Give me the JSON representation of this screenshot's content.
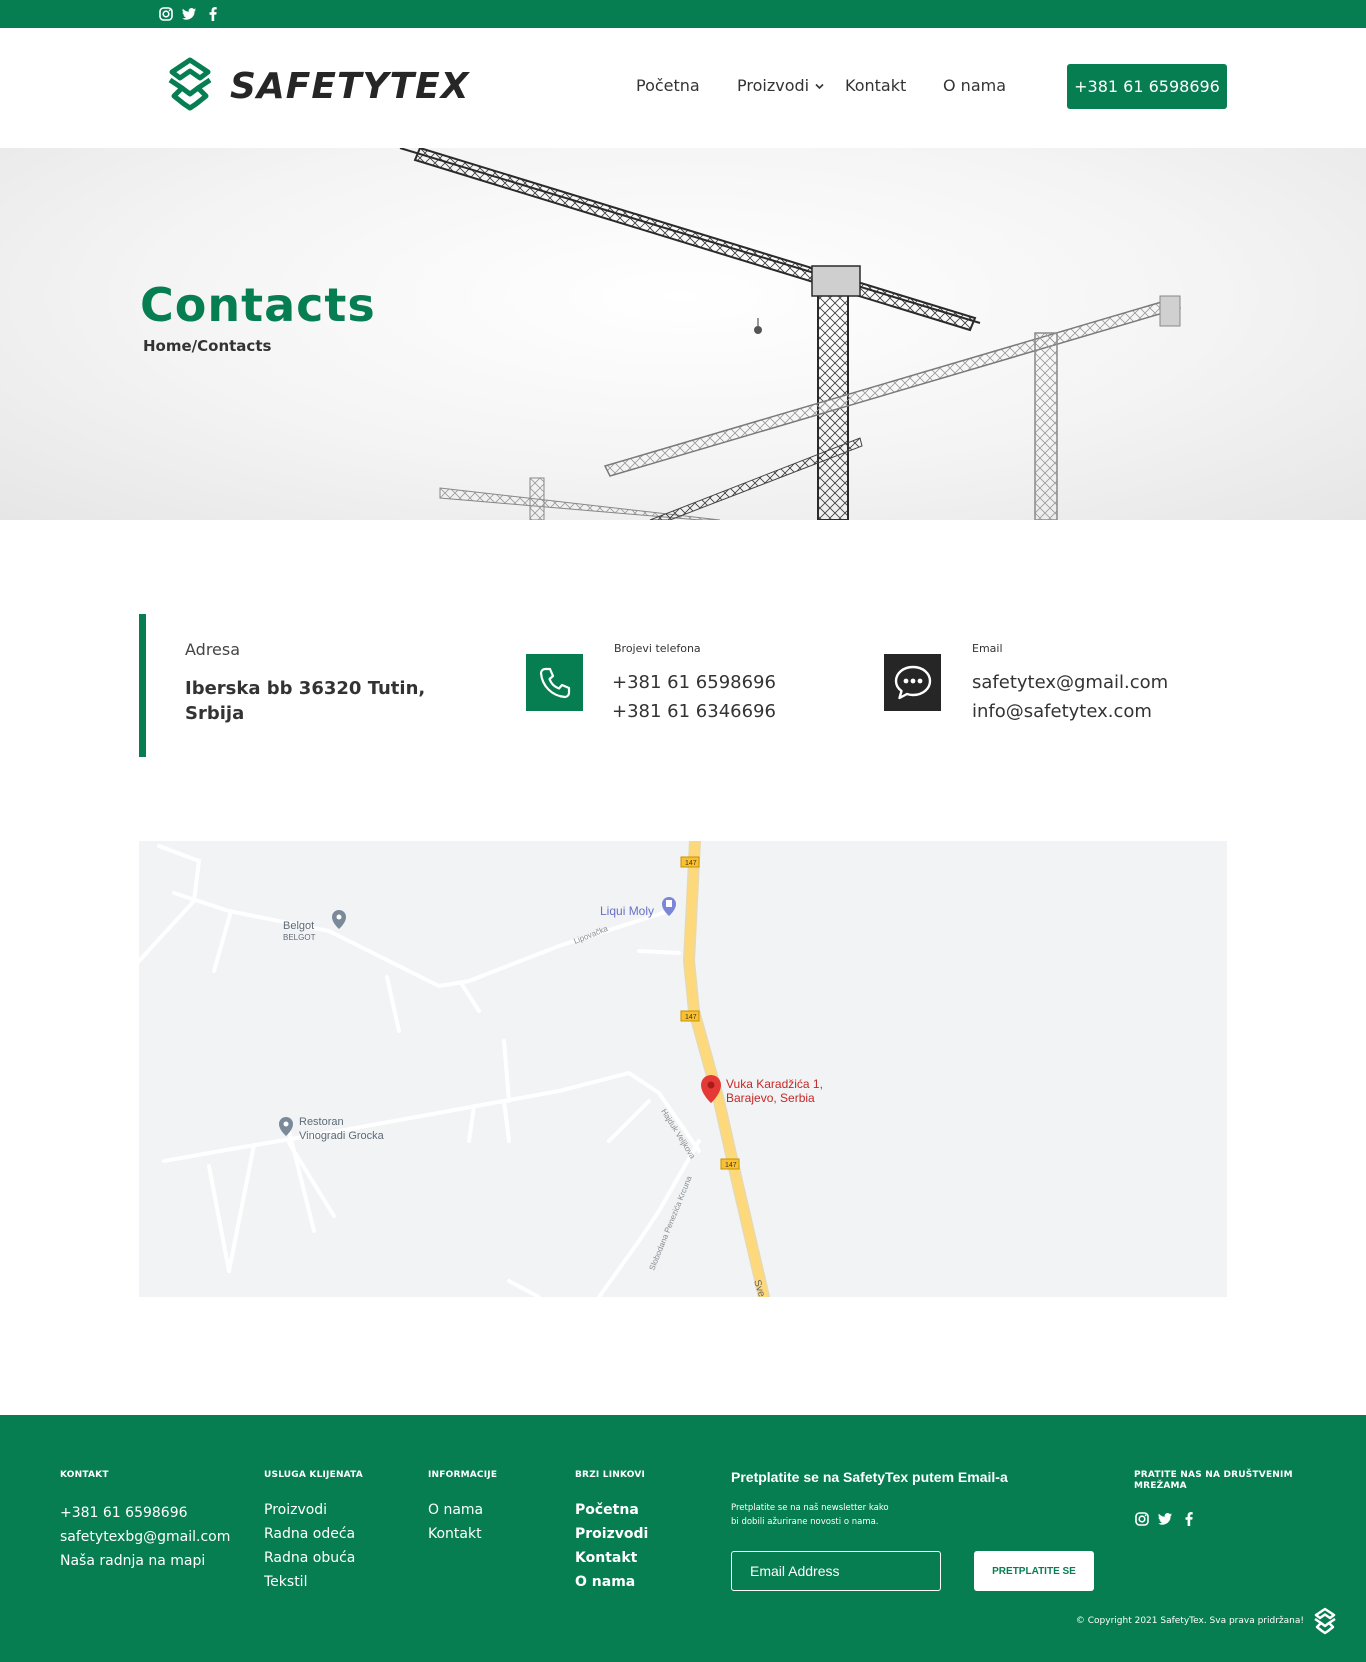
{
  "topbar": {
    "social_icons": [
      "instagram-icon",
      "twitter-icon",
      "facebook-icon"
    ]
  },
  "header": {
    "logo_text": "SAFETYTEX",
    "nav": [
      {
        "label": "Početna"
      },
      {
        "label": "Proizvodi"
      },
      {
        "label": "Kontakt"
      },
      {
        "label": "O nama"
      }
    ],
    "phone_button": "+381 61 6598696"
  },
  "hero": {
    "title": "Contacts",
    "breadcrumb": "Home/Contacts"
  },
  "contacts": {
    "address_label": "Adresa",
    "address_line1": "Iberska bb 36320 Tutin,",
    "address_line2": "Srbija",
    "phones_label": "Brojevi telefona",
    "phone1": "+381 61 6598696",
    "phone2": "+381 61 6346696",
    "email_label": "Email",
    "email1": "safetytex@gmail.com",
    "email2": "info@safetytex.com"
  },
  "map": {
    "places": {
      "belgot": "Belgot",
      "belgot_sub": "BELGOT",
      "liqui": "Liqui Moly",
      "lipovacka": "Lipovačka",
      "restoran1": "Restoran",
      "restoran2": "Vinogradi Grocka",
      "pin1": "Vuka Karadžića 1,",
      "pin2": "Barajevo, Serbia",
      "hajduk": "Hajduk Veljkova",
      "slobodana": "Slobodana Penezića Krcuna",
      "road_label": "147",
      "sve": "Sve"
    }
  },
  "footer": {
    "kontakt": {
      "heading": "KONTAKT",
      "items": [
        "+381 61 6598696",
        "safetytexbg@gmail.com",
        "Naša radnja na mapi"
      ]
    },
    "usluga": {
      "heading": "USLUGA KLIJENATA",
      "items": [
        "Proizvodi",
        "Radna odeća",
        "Radna obuća",
        "Tekstil"
      ]
    },
    "informacije": {
      "heading": "INFORMACIJE",
      "items": [
        "O nama",
        "Kontakt"
      ]
    },
    "brzi": {
      "heading": "BRZI LINKOVI",
      "items": [
        "Početna",
        "Proizvodi",
        "Kontakt",
        "O nama"
      ]
    },
    "newsletter": {
      "title": "Pretplatite se na SafetyTex putem Email-a",
      "subtitle_line1": "Pretplatite se na naš newsletter kako",
      "subtitle_line2": "bi dobili ažurirane novosti o nama.",
      "input_placeholder": "Email Address",
      "button": "PRETPLATITE SE"
    },
    "social": {
      "heading_line1": "PRATITE NAS NA DRUŠTVENIM",
      "heading_line2": "MREŽAMA"
    },
    "copyright": "© Copyright 2021 SafetyTex. Sva prava pridržana!"
  },
  "colors": {
    "brand_green": "#067e52",
    "dark": "#262626",
    "map_bg": "#f1f3f4",
    "road_yellow": "#fdd97c",
    "pin_red": "#e53935"
  }
}
